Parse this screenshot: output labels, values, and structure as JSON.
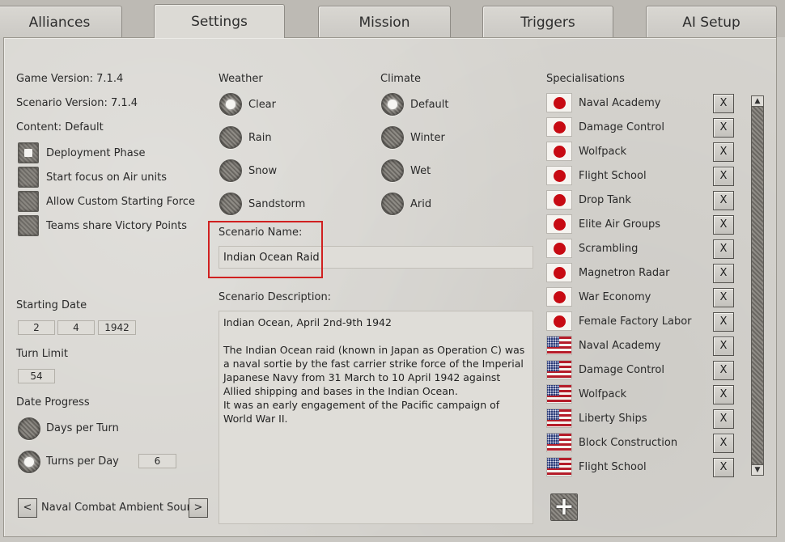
{
  "tabs": [
    "Alliances",
    "Settings",
    "Mission",
    "Triggers",
    "AI Setup"
  ],
  "active_tab": "Settings",
  "game_version": "Game Version: 7.1.4",
  "scenario_version": "Scenario Version: 7.1.4",
  "content": "Content: Default",
  "options": [
    {
      "label": "Deployment Phase",
      "checked": true
    },
    {
      "label": "Start focus on Air units",
      "checked": false
    },
    {
      "label": "Allow Custom Starting Force",
      "checked": false
    },
    {
      "label": "Teams share Victory Points",
      "checked": false
    }
  ],
  "starting_date": {
    "label": "Starting Date",
    "day": "2",
    "month": "4",
    "year": "1942"
  },
  "turn_limit": {
    "label": "Turn Limit",
    "value": "54"
  },
  "date_progress": {
    "label": "Date Progress",
    "days_per_turn": "Days per Turn",
    "turns_per_day": "Turns per Day",
    "turns_per_day_value": "6",
    "selected": "Turns per Day"
  },
  "ambient_sound": {
    "prev": "<",
    "label": "Naval Combat Ambient Sound",
    "next": ">"
  },
  "weather": {
    "label": "Weather",
    "options": [
      "Clear",
      "Rain",
      "Snow",
      "Sandstorm"
    ],
    "selected": "Clear"
  },
  "climate": {
    "label": "Climate",
    "options": [
      "Default",
      "Winter",
      "Wet",
      "Arid"
    ],
    "selected": "Default"
  },
  "scenario_name": {
    "label": "Scenario Name:",
    "value": "Indian Ocean Raid"
  },
  "scenario_description": {
    "label": "Scenario Description:",
    "line1": "Indian Ocean, April 2nd-9th 1942",
    "para2": "The Indian Ocean raid (known in Japan as Operation C) was a naval sortie by the fast carrier strike force of the Imperial Japanese Navy from 31 March to 10 April 1942 against Allied shipping and bases in the Indian Ocean.",
    "para3": "It was an early engagement of the Pacific campaign of World War II."
  },
  "specialisations": {
    "label": "Specialisations",
    "remove_label": "X",
    "add_icon": "plus-icon",
    "items": [
      {
        "nation": "japan",
        "name": "Naval Academy"
      },
      {
        "nation": "japan",
        "name": "Damage Control"
      },
      {
        "nation": "japan",
        "name": "Wolfpack"
      },
      {
        "nation": "japan",
        "name": "Flight School"
      },
      {
        "nation": "japan",
        "name": "Drop Tank"
      },
      {
        "nation": "japan",
        "name": "Elite Air Groups"
      },
      {
        "nation": "japan",
        "name": "Scrambling"
      },
      {
        "nation": "japan",
        "name": "Magnetron Radar"
      },
      {
        "nation": "japan",
        "name": "War Economy"
      },
      {
        "nation": "japan",
        "name": "Female Factory Labor"
      },
      {
        "nation": "usa",
        "name": "Naval Academy"
      },
      {
        "nation": "usa",
        "name": "Damage Control"
      },
      {
        "nation": "usa",
        "name": "Wolfpack"
      },
      {
        "nation": "usa",
        "name": "Liberty Ships"
      },
      {
        "nation": "usa",
        "name": "Block Construction"
      },
      {
        "nation": "usa",
        "name": "Flight School"
      }
    ]
  },
  "colors": {
    "highlight": "#d02020",
    "japan_red": "#c70a12",
    "usa_blue": "#2b3d7a"
  }
}
